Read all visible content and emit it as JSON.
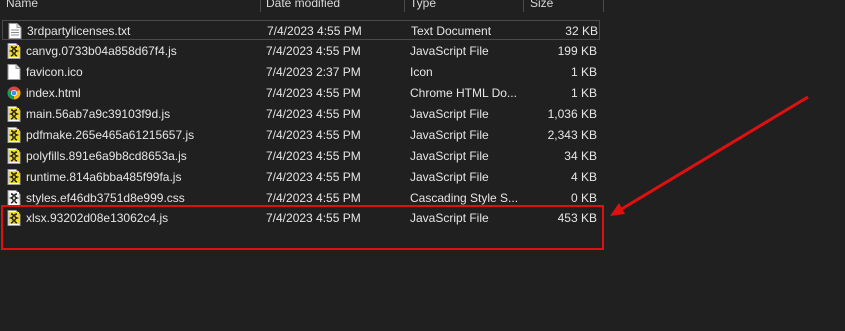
{
  "header": {
    "name": "Name",
    "date": "Date modified",
    "type": "Type",
    "size": "Size"
  },
  "files": [
    {
      "name": "3rdpartylicenses.txt",
      "date": "7/4/2023 4:55 PM",
      "type": "Text Document",
      "size": "32 KB",
      "icon": "text-file-icon"
    },
    {
      "name": "canvg.0733b04a858d67f4.js",
      "date": "7/4/2023 4:55 PM",
      "type": "JavaScript File",
      "size": "199 KB",
      "icon": "javascript-file-icon"
    },
    {
      "name": "favicon.ico",
      "date": "7/4/2023 2:37 PM",
      "type": "Icon",
      "size": "1 KB",
      "icon": "generic-file-icon"
    },
    {
      "name": "index.html",
      "date": "7/4/2023 4:55 PM",
      "type": "Chrome HTML Do...",
      "size": "1 KB",
      "icon": "chrome-icon"
    },
    {
      "name": "main.56ab7a9c39103f9d.js",
      "date": "7/4/2023 4:55 PM",
      "type": "JavaScript File",
      "size": "1,036 KB",
      "icon": "javascript-file-icon"
    },
    {
      "name": "pdfmake.265e465a61215657.js",
      "date": "7/4/2023 4:55 PM",
      "type": "JavaScript File",
      "size": "2,343 KB",
      "icon": "javascript-file-icon"
    },
    {
      "name": "polyfills.891e6a9b8cd8653a.js",
      "date": "7/4/2023 4:55 PM",
      "type": "JavaScript File",
      "size": "34 KB",
      "icon": "javascript-file-icon"
    },
    {
      "name": "runtime.814a6bba485f99fa.js",
      "date": "7/4/2023 4:55 PM",
      "type": "JavaScript File",
      "size": "4 KB",
      "icon": "javascript-file-icon"
    },
    {
      "name": "styles.ef46db3751d8e999.css",
      "date": "7/4/2023 4:55 PM",
      "type": "Cascading Style S...",
      "size": "0 KB",
      "icon": "css-file-icon"
    },
    {
      "name": "xlsx.93202d08e13062c4.js",
      "date": "7/4/2023 4:55 PM",
      "type": "JavaScript File",
      "size": "453 KB",
      "icon": "javascript-file-icon"
    }
  ],
  "colors": {
    "background": "#202020",
    "text": "#e6e6e6",
    "annotation": "#e01010",
    "js_icon": "#f2d92a"
  }
}
